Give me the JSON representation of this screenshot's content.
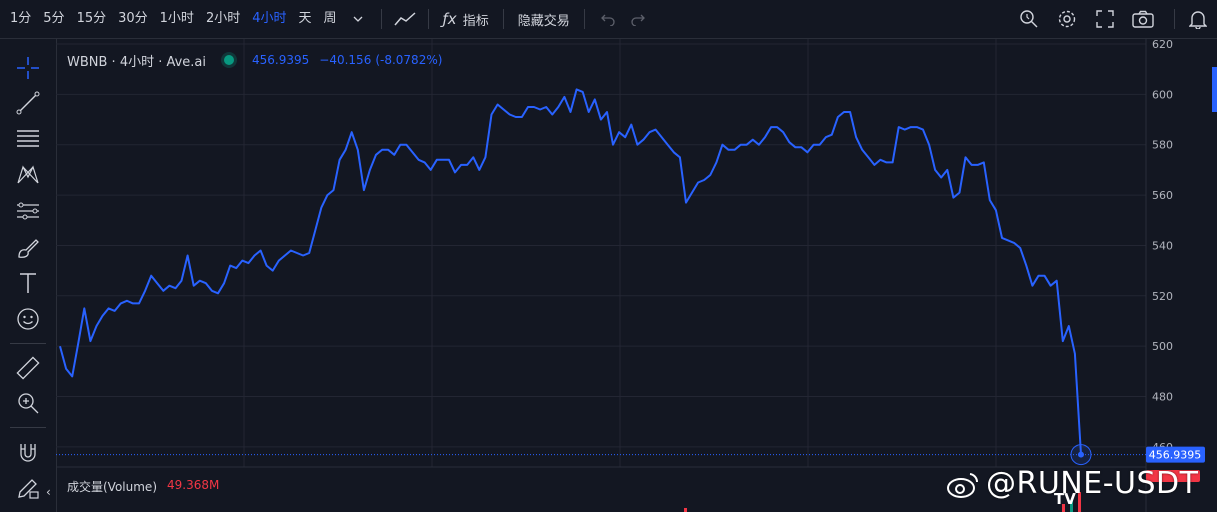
{
  "toolbar": {
    "timeframes": [
      "1分",
      "5分",
      "15分",
      "30分",
      "1小时",
      "2小时",
      "4小时",
      "天",
      "周"
    ],
    "active_timeframe": "4小时",
    "indicators_label": "指标",
    "hide_trading_label": "隐藏交易",
    "icons": [
      "chevron-down-icon",
      "line-chart-icon",
      "fx-icon",
      "undo-icon",
      "redo-icon",
      "search-zoom-icon",
      "gear-icon",
      "fullscreen-icon",
      "camera-icon",
      "bell-icon"
    ]
  },
  "left_tools": [
    "crosshair-icon",
    "trend-line-icon",
    "fib-lines-icon",
    "pattern-icon",
    "prediction-icon",
    "brush-icon",
    "text-icon",
    "emoji-icon",
    "ruler-icon",
    "zoom-in-icon",
    "magnet-icon",
    "lock-draw-icon"
  ],
  "legend": {
    "symbol": "WBNB · 4小时 · Ave.ai",
    "price": "456.9395",
    "change": "−40.156",
    "change_pct": "(-8.0782%)"
  },
  "volume_legend": {
    "label": "成交量(Volume)",
    "value": "49.368M"
  },
  "price_tag": "456.9395",
  "watermark": "@RUNE-USDT",
  "colors": {
    "background": "#131722",
    "line": "#2962ff",
    "grid": "#232633",
    "volume_value": "#f23645",
    "legend_dot": "#089981"
  },
  "chart_data": {
    "type": "line",
    "title": "WBNB · 4小时 · Ave.ai",
    "ylim": [
      452,
      622
    ],
    "y_ticks": [
      460,
      480,
      500,
      520,
      540,
      560,
      580,
      600,
      620
    ],
    "grid": true,
    "series": [
      {
        "values": [
          500,
          491,
          488,
          501,
          515,
          502,
          508,
          512,
          515,
          514,
          517,
          518,
          517,
          517,
          522,
          528,
          525,
          522,
          524,
          523,
          526,
          536,
          524,
          526,
          525,
          522,
          521,
          525,
          532,
          531,
          534,
          533,
          536,
          538,
          532,
          530,
          534,
          536,
          538,
          537,
          536,
          537,
          546,
          555,
          560,
          562,
          574,
          578,
          585,
          578,
          562,
          570,
          576,
          578,
          578,
          576,
          580,
          580,
          577,
          574,
          573,
          570,
          574,
          574,
          574,
          569,
          572,
          572,
          575,
          570,
          575,
          592,
          596,
          594,
          592,
          591,
          591,
          595,
          595,
          594,
          595,
          592,
          595,
          599,
          593,
          602,
          601,
          593,
          598,
          590,
          593,
          580,
          585,
          583,
          588,
          580,
          582,
          585,
          586,
          583,
          580,
          577,
          575,
          557,
          561,
          565,
          566,
          568,
          573,
          580,
          578,
          578,
          580,
          580,
          582,
          580,
          583,
          587,
          587,
          585,
          581,
          579,
          579,
          577,
          580,
          580,
          583,
          584,
          591,
          593,
          593,
          583,
          578,
          575,
          572,
          574,
          573,
          573,
          587,
          586,
          587,
          587,
          586,
          580,
          570,
          567,
          570,
          559,
          561,
          575,
          572,
          572,
          573,
          558,
          554,
          543,
          542,
          541,
          539,
          532,
          524,
          528,
          528,
          524,
          526,
          502,
          508,
          497,
          456.94
        ]
      }
    ]
  }
}
